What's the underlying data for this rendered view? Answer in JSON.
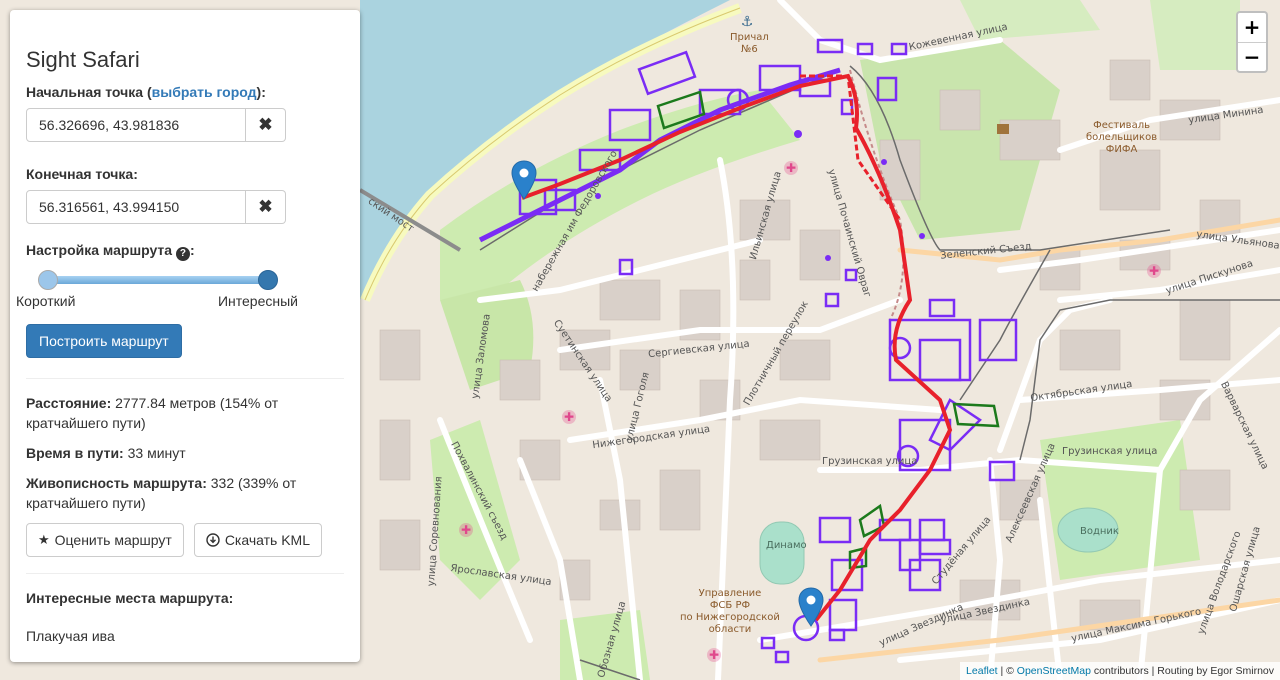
{
  "app": {
    "title": "Sight Safari"
  },
  "start": {
    "label_prefix": "Начальная точка (",
    "label_link": "выбрать город",
    "label_suffix": "):",
    "value": "56.326696, 43.981836",
    "clear_icon": "✖"
  },
  "end": {
    "label": "Конечная точка:",
    "value": "56.316561, 43.994150",
    "clear_icon": "✖"
  },
  "route_settings": {
    "label": "Настройка маршрута",
    "help_icon": "❓",
    "min_label": "Короткий",
    "max_label": "Интересный",
    "slider_value": 1.0
  },
  "build_button": "Построить маршрут",
  "stats": {
    "distance_label": "Расстояние:",
    "distance_value": " 2777.84 метров (154% от кратчайшего пути)",
    "time_label": "Время в пути:",
    "time_value": " 33 минут",
    "scenic_label": "Живописность маршрута:",
    "scenic_value": " 332 (339% от кратчайшего пути)"
  },
  "rate_button": "Оценить маршрут",
  "download_button": "Скачать KML",
  "places": {
    "heading": "Интересные места маршрута:",
    "items": [
      "Плакучая ива"
    ]
  },
  "zoom": {
    "in": "+",
    "out": "−"
  },
  "attribution": {
    "leaflet": "Leaflet",
    "sep": " | © ",
    "osm": "OpenStreetMap",
    "rest": " contributors | Routing by Egor Smirnov"
  },
  "map_labels": {
    "pier": "Причал",
    "pier_no": "№6",
    "kozhevennaya": "Кожевенная улица",
    "festival_1": "Фестиваль",
    "festival_2": "болельщиков",
    "festival_3": "ФИФА",
    "minina": "улица Минина",
    "ulyanova": "улица Ульянова",
    "zelensky": "Зеленский Съезд",
    "piskunova": "улица Пискунова",
    "fedorovskogo": "набережная им Федоровского",
    "ilinskaya": "Ильинская улица",
    "pochainsky": "улица Почаинский Овраг",
    "suetinskaya": "Суетинская улица",
    "sergievskaya": "Сергиевская улица",
    "plotnichny": "Плотничный переулок",
    "oktyabrskaya": "Октябрьская улица",
    "varvarskaya": "Варварская улица",
    "nizhegorodskaya": "Нижегородская улица",
    "gruzinskaya": "Грузинская улица",
    "gruzinskaya2": "Грузинская улица",
    "alekseevskaya": "Алексеевская улица",
    "pokhvalinsky": "Похвалинский съезд",
    "zvezdinka": "улица Звездинка",
    "zvezdinka2": "улица Звездинка",
    "gorkogo": "улица Максима Горького",
    "dinamo": "Динамо",
    "vodnik": "Водник",
    "fsb_1": "Управление",
    "fsb_2": "ФСБ РФ",
    "fsb_3": "по Нижегородской",
    "fsb_4": "области",
    "most": "ский мост",
    "gogolya": "улица Гоголя",
    "zalomova": "улица Заломова",
    "sorevnovaniya": "улица Соревнования",
    "yaroslavskaya": "Ярославская улица",
    "oboznaya": "Обозная улица",
    "studenaya": "Студёная улица",
    "volodarskogo": "улица Володарского",
    "osharskaya": "Ошарская улица"
  },
  "colors": {
    "route": "#e8212b",
    "sight_outline": "#7a2cf5",
    "green_outline": "#1c7a1c",
    "marker": "#2a81cb",
    "water": "#aad3df",
    "primary": "#337ab7"
  }
}
